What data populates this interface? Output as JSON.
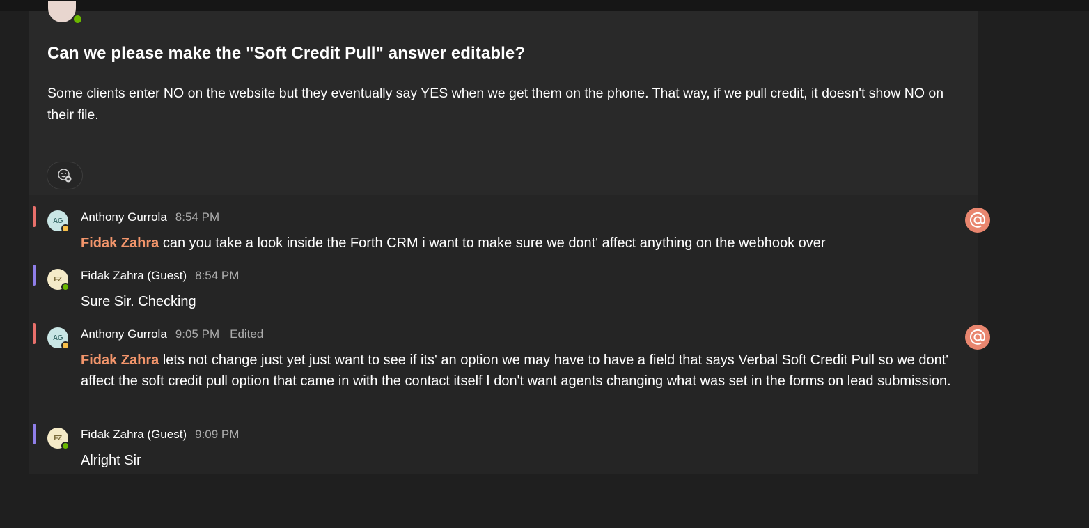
{
  "post": {
    "title": "Can we please make the \"Soft Credit Pull\" answer editable?",
    "body": "Some clients enter NO on the website but they eventually say YES when we get them on the phone. That way, if we pull credit, it doesn't show NO on their file."
  },
  "colors": {
    "background": "#1f1f1f",
    "card": "#292929",
    "mention_accent": "#f2956b",
    "mention_badge": "#e9866f",
    "bar_anthony": "#e8706b",
    "bar_fidak": "#8f7ee8"
  },
  "replies": [
    {
      "initials": "AG",
      "author": "Anthony Gurrola",
      "time": "8:54 PM",
      "mention": "Fidak Zahra",
      "text": " can you take a look inside the Forth CRM i want to make sure we dont' affect anything on the webhook over"
    },
    {
      "initials": "FZ",
      "author": "Fidak Zahra (Guest)",
      "time": "8:54 PM",
      "text": "Sure Sir. Checking"
    },
    {
      "initials": "AG",
      "author": "Anthony Gurrola",
      "time": "9:05 PM",
      "edited": "Edited",
      "mention": "Fidak Zahra",
      "text": " lets not change just yet just want to see if its' an option we may have to have a field that says Verbal Soft Credit Pull so we dont' affect the soft credit pull option that came in with the contact itself I don't want agents changing what was set in the forms on lead submission."
    },
    {
      "initials": "FZ",
      "author": "Fidak Zahra (Guest)",
      "time": "9:09 PM",
      "text": "Alright Sir"
    }
  ],
  "icons": {
    "reaction": "add-reaction-icon",
    "mention": "at-mention-icon",
    "presence": "presence-status-icon"
  }
}
